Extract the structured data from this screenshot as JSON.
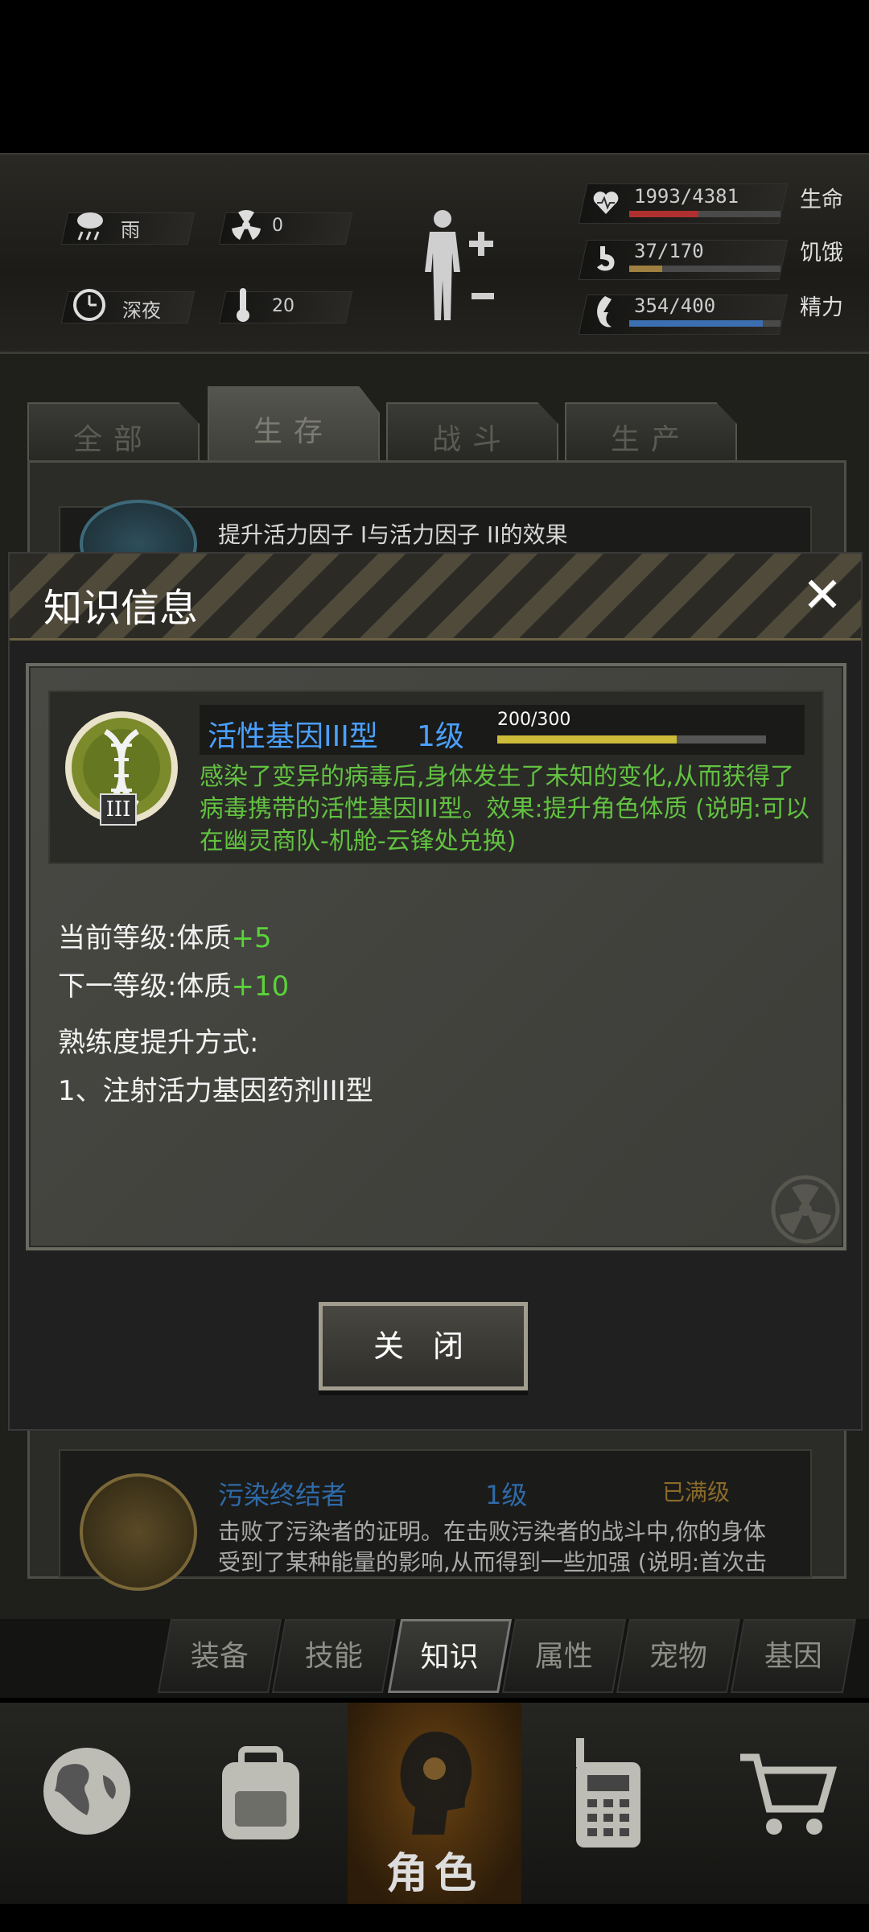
{
  "status": {
    "weather": "雨",
    "radiation": "0",
    "time_of_day": "深夜",
    "temperature": "20",
    "body_icon": "body-figure-icon",
    "stats": [
      {
        "name": "生命",
        "value": "1993/4381",
        "fill": 0.455,
        "color": "#b03030",
        "icon": "heart-icon"
      },
      {
        "name": "饥饿",
        "value": "37/170",
        "fill": 0.218,
        "color": "#a08040",
        "icon": "stomach-icon"
      },
      {
        "name": "精力",
        "value": "354/400",
        "fill": 0.885,
        "color": "#3b6fb2",
        "icon": "energy-icon"
      }
    ]
  },
  "tabs": [
    "全部",
    "生存",
    "战斗",
    "生产"
  ],
  "active_tab": "生存",
  "list": {
    "top_item_desc": "提升活力因子 I与活力因子 II的效果",
    "bottom_item": {
      "name": "污染终结者",
      "level": "1级",
      "status": "已满级",
      "desc": "击败了污染者的证明。在击败污染者的战斗中,你的身体受到了某种能量的影响,从而得到一些加强 (说明:首次击败污染"
    }
  },
  "modal": {
    "title": "知识信息",
    "gene": {
      "name": "活性基因III型",
      "level": "1级",
      "xp": "200/300",
      "xp_fraction": 0.6667,
      "numeral": "III",
      "description": "感染了变异的病毒后,身体发生了未知的变化,从而获得了病毒携带的活性基因III型。效果:提升角色体质 (说明:可以在幽灵商队-机舱-云锋处兑换)"
    },
    "current_label": "当前等级:",
    "current_stat": "体质",
    "current_bonus": "+5",
    "next_label": "下一等级:",
    "next_stat": "体质",
    "next_bonus": "+10",
    "method_title": "熟练度提升方式:",
    "method_item": "1、注射活力基因药剂III型",
    "close_button": "关 闭"
  },
  "subtabs": [
    "装备",
    "技能",
    "知识",
    "属性",
    "宠物",
    "基因"
  ],
  "active_subtab": "知识",
  "nav": {
    "items": [
      "globe-icon",
      "backpack-icon",
      "character-head-icon",
      "radio-icon",
      "cart-icon"
    ],
    "active_label": "角色"
  }
}
